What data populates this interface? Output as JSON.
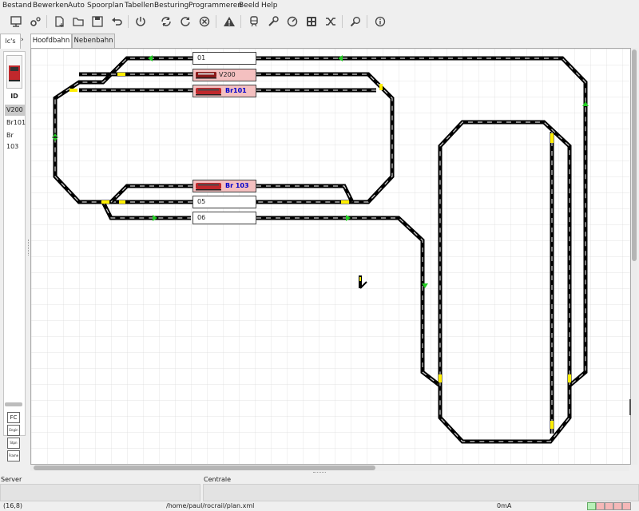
{
  "menu": [
    "Bestand",
    "Bewerken",
    "Auto",
    "Spoorplan",
    "Tabellen",
    "Besturing",
    "Programmeren",
    "Beeld",
    "Help"
  ],
  "toolbar_icons": [
    "monitor-icon",
    "settings-cog-icon",
    "new-file-icon",
    "open-folder-icon",
    "save-icon",
    "undo-icon",
    "power-icon",
    "sync-icon",
    "refresh-icon",
    "cancel-icon",
    "warning-icon",
    "train-icon",
    "wrench-icon",
    "gauge-icon",
    "grid-icon",
    "shuffle-icon",
    "search-icon",
    "info-icon"
  ],
  "left_panel": {
    "tab_label": "lc's",
    "column_header": "ID",
    "locos": [
      "V200",
      "Br101",
      "Br 103"
    ],
    "side_buttons": [
      "FC",
      "Engin",
      "Stpn",
      "Frame"
    ]
  },
  "tabs": [
    "Hoofdbahn",
    "Nebenbahn"
  ],
  "blocks": [
    {
      "id": "01",
      "occupied": false,
      "loco": ""
    },
    {
      "id": "V200",
      "occupied": true,
      "loco": "V200"
    },
    {
      "id": "Br101",
      "occupied": true,
      "loco": "Br101"
    },
    {
      "id": "Br 103",
      "occupied": true,
      "loco": "Br 103"
    },
    {
      "id": "05",
      "occupied": false,
      "loco": ""
    },
    {
      "id": "06",
      "occupied": false,
      "loco": ""
    }
  ],
  "panels": {
    "server_label": "Server",
    "centrale_label": "Centrale"
  },
  "status": {
    "coords": "(16,8)",
    "path": "/home/paul/rocrail/plan.xml",
    "current": "0mA"
  },
  "colors": {
    "occupied_block": "#f4c0c0",
    "signal_green": "#22cc22",
    "track_dash_yellow": "#ffee00",
    "loco_red": "#c0282c"
  }
}
